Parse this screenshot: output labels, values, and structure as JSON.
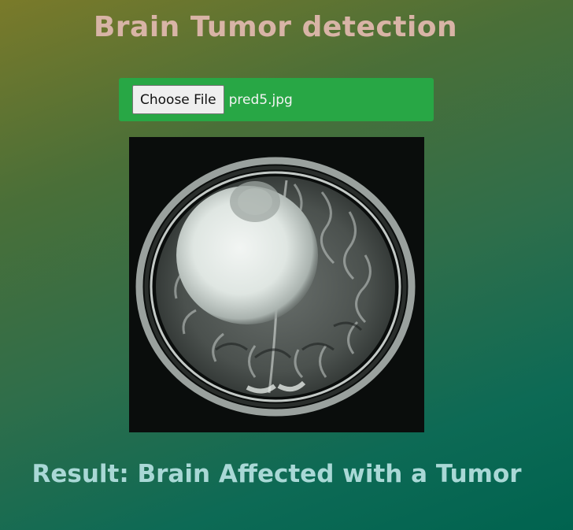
{
  "page": {
    "title": "Brain Tumor detection"
  },
  "upload": {
    "choose_label": "Choose File",
    "file_name": "pred5.jpg"
  },
  "result": {
    "text": "Result: Brain Affected with a Tumor"
  },
  "colors": {
    "title": "#d8b4a6",
    "upload_bar": "#28a745",
    "result_text": "#a9d8d6"
  }
}
